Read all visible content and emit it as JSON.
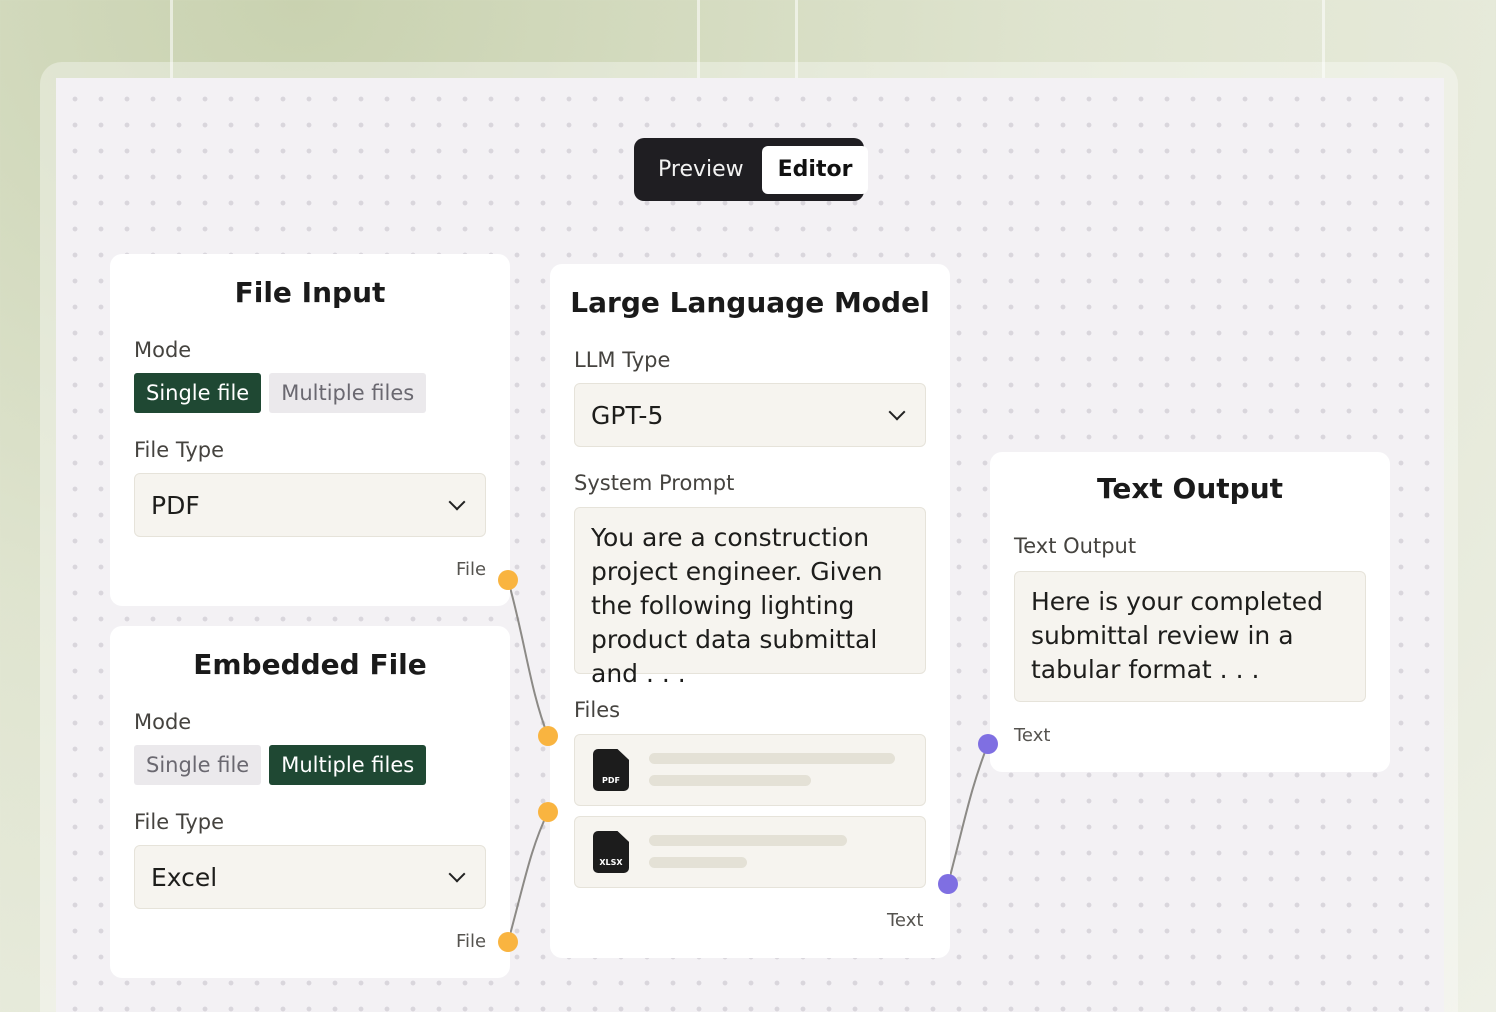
{
  "view_toggle": {
    "preview": "Preview",
    "editor": "Editor"
  },
  "file_input": {
    "title": "File Input",
    "mode_label": "Mode",
    "mode_single": "Single file",
    "mode_multiple": "Multiple files",
    "selected_mode": "Single file",
    "file_type_label": "File Type",
    "file_type": "PDF",
    "port_label": "File"
  },
  "embedded_file": {
    "title": "Embedded File",
    "mode_label": "Mode",
    "mode_single": "Single file",
    "mode_multiple": "Multiple files",
    "selected_mode": "Multiple files",
    "file_type_label": "File Type",
    "file_type": "Excel",
    "port_label": "File"
  },
  "llm": {
    "title": "Large Language Model",
    "type_label": "LLM Type",
    "type_value": "GPT-5",
    "prompt_label": "System Prompt",
    "prompt_text": "You are a construction project engineer. Given the following lighting product data submittal and . . .",
    "files_label": "Files",
    "files": [
      {
        "ext": "PDF"
      },
      {
        "ext": "XLSX"
      }
    ],
    "output_label": "Text"
  },
  "text_output": {
    "title": "Text Output",
    "field_label": "Text Output",
    "field_text": "Here is your completed submittal review in a tabular format . . .",
    "port_label": "Text"
  },
  "colors": {
    "selected_segment": "#1f4833",
    "file_port": "#f9b440",
    "text_port": "#7f6fe2"
  }
}
